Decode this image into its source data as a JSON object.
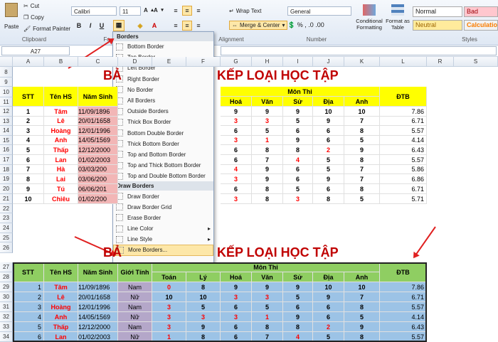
{
  "ribbon": {
    "paste": "Paste",
    "cut": "Cut",
    "copy": "Copy",
    "format_painter": "Format Painter",
    "clipboard": "Clipboard",
    "font_name": "Calibri",
    "font_size": "11",
    "bold": "B",
    "italic": "I",
    "underline": "U",
    "font_group": "Fo",
    "wrap_text": "Wrap Text",
    "merge_center": "Merge & Center",
    "alignment": "Alignment",
    "number_format": "General",
    "number": "Number",
    "conditional_formatting": "Conditional Formatting",
    "format_as_table": "Format as Table",
    "styles": "Styles",
    "style_normal": "Normal",
    "style_bad": "Bad",
    "style_neutral": "Neutral",
    "style_calculation": "Calculatio"
  },
  "name_box": "A27",
  "columns": [
    "A",
    "B",
    "C",
    "D",
    "E",
    "F",
    "G",
    "H",
    "I",
    "J",
    "K",
    "L",
    "R",
    "S"
  ],
  "rows_top": [
    "8",
    "9",
    "10",
    "11",
    "12",
    "13",
    "14",
    "15",
    "16",
    "17",
    "18",
    "19",
    "20",
    "21",
    "22",
    "23",
    "24",
    "25",
    "26"
  ],
  "rows_bottom": [
    "27",
    "28",
    "29",
    "30",
    "31",
    "32",
    "33",
    "34"
  ],
  "title_top": "BẢ",
  "title_top_right": "KẾP LOẠI HỌC TẬP",
  "title_bottom": "BẢ",
  "title_bottom_right": "KẾP LOẠI HỌC TẬP",
  "headers": {
    "stt": "STT",
    "ten": "Tên HS",
    "ngay": "Năm Sinh",
    "gioi": "Giới Tính",
    "mon": "Môn Thi",
    "toan": "Toán",
    "ly": "Lý",
    "hoa": "Hoá",
    "van": "Văn",
    "su": "Sử",
    "dia": "Địa",
    "anh": "Anh",
    "dtb": "ĐTB"
  },
  "students": [
    {
      "stt": "1",
      "ten": "Tâm",
      "ngay": "11/09/1896",
      "gioi": "Nam",
      "toan": "0",
      "ly": "8",
      "hoa": "9",
      "van": "9",
      "su": "9",
      "dia": "10",
      "anh": "10",
      "dtb": "7.86"
    },
    {
      "stt": "2",
      "ten": "Lê",
      "ngay": "20/01/1658",
      "gioi": "Nữ",
      "toan": "10",
      "ly": "10",
      "hoa": "3",
      "van": "3",
      "su": "5",
      "dia": "9",
      "anh": "7",
      "dtb": "6.71"
    },
    {
      "stt": "3",
      "ten": "Hoàng",
      "ngay": "12/01/1996",
      "gioi": "Nam",
      "toan": "3",
      "ly": "5",
      "hoa": "6",
      "van": "5",
      "su": "6",
      "dia": "6",
      "anh": "8",
      "dtb": "5.57"
    },
    {
      "stt": "4",
      "ten": "Anh",
      "ngay": "14/05/1569",
      "gioi": "Nữ",
      "toan": "3",
      "ly": "3",
      "hoa": "3",
      "van": "1",
      "su": "9",
      "dia": "6",
      "anh": "5",
      "dtb": "4.14"
    },
    {
      "stt": "5",
      "ten": "Thấp",
      "ngay": "12/12/2000",
      "gioi": "Nam",
      "toan": "3",
      "ly": "9",
      "hoa": "6",
      "van": "8",
      "su": "8",
      "dia": "2",
      "anh": "9",
      "dtb": "6.43"
    },
    {
      "stt": "6",
      "ten": "Lan",
      "ngay": "01/02/2003",
      "gioi": "Nữ",
      "toan": "1",
      "ly": "8",
      "hoa": "6",
      "van": "7",
      "su": "4",
      "dia": "5",
      "anh": "8",
      "dtb": "5.57"
    },
    {
      "stt": "7",
      "ten": "Hà",
      "ngay": "03/03/200",
      "gioi": "",
      "toan": "",
      "ly": "",
      "hoa": "4",
      "van": "9",
      "su": "6",
      "dia": "5",
      "anh": "7",
      "dtb": "5.86"
    },
    {
      "stt": "8",
      "ten": "Lai",
      "ngay": "03/06/200",
      "gioi": "",
      "toan": "",
      "ly": "",
      "hoa": "3",
      "van": "9",
      "su": "6",
      "dia": "9",
      "anh": "7",
      "dtb": "6.86"
    },
    {
      "stt": "9",
      "ten": "Tú",
      "ngay": "06/06/201",
      "gioi": "",
      "toan": "",
      "ly": "",
      "hoa": "6",
      "van": "8",
      "su": "5",
      "dia": "6",
      "anh": "8",
      "dtb": "6.71"
    },
    {
      "stt": "10",
      "ten": "Chiêu",
      "ngay": "01/02/200",
      "gioi": "",
      "toan": "",
      "ly": "",
      "hoa": "3",
      "van": "8",
      "su": "3",
      "dia": "8",
      "anh": "5",
      "dtb": "5.71"
    }
  ],
  "menu": {
    "header": "Borders",
    "items": [
      "Bottom Border",
      "Top Border",
      "Left Border",
      "Right Border",
      "No Border",
      "All Borders",
      "Outside Borders",
      "Thick Box Border",
      "Bottom Double Border",
      "Thick Bottom Border",
      "Top and Bottom Border",
      "Top and Thick Bottom Border",
      "Top and Double Bottom Border"
    ],
    "draw_header": "Draw Borders",
    "draw_items": [
      "Draw Border",
      "Draw Border Grid",
      "Erase Border",
      "Line Color",
      "Line Style",
      "More Borders..."
    ]
  },
  "colors": {
    "yellow": "#ffff00",
    "green": "#8fce62",
    "blue": "#9cc3e6",
    "pink": "#f2b6b6",
    "gray": "#b4a7c9",
    "red": "#ff0000"
  }
}
